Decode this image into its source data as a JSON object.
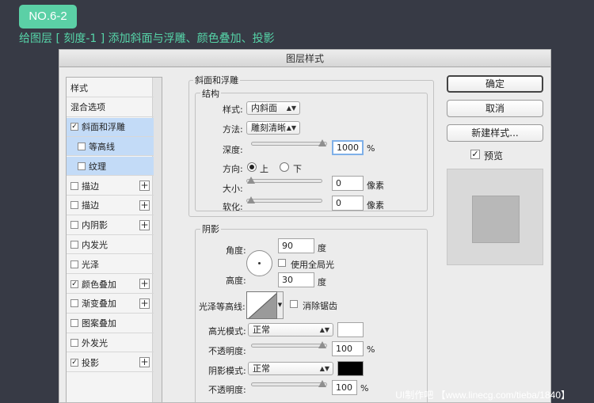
{
  "tutorial": {
    "badge": "NO.6-2",
    "subtitle": "给图层 [ 刻度-1 ] 添加斜面与浮雕、颜色叠加、投影"
  },
  "dialog": {
    "title": "图层样式",
    "buttons": {
      "ok": "确定",
      "cancel": "取消",
      "new_style": "新建样式...",
      "preview": "预览"
    }
  },
  "sidebar": {
    "items": [
      {
        "label": "样式",
        "has_checkbox": false,
        "checked": false,
        "plus": false,
        "selected": false,
        "sub": false
      },
      {
        "label": "混合选项",
        "has_checkbox": false,
        "checked": false,
        "plus": false,
        "selected": false,
        "sub": false
      },
      {
        "label": "斜面和浮雕",
        "has_checkbox": true,
        "checked": true,
        "plus": false,
        "selected": true,
        "sub": false
      },
      {
        "label": "等高线",
        "has_checkbox": true,
        "checked": false,
        "plus": false,
        "selected": true,
        "sub": true
      },
      {
        "label": "纹理",
        "has_checkbox": true,
        "checked": false,
        "plus": false,
        "selected": true,
        "sub": true
      },
      {
        "label": "描边",
        "has_checkbox": true,
        "checked": false,
        "plus": true,
        "selected": false,
        "sub": false
      },
      {
        "label": "描边",
        "has_checkbox": true,
        "checked": false,
        "plus": true,
        "selected": false,
        "sub": false
      },
      {
        "label": "内阴影",
        "has_checkbox": true,
        "checked": false,
        "plus": true,
        "selected": false,
        "sub": false
      },
      {
        "label": "内发光",
        "has_checkbox": true,
        "checked": false,
        "plus": false,
        "selected": false,
        "sub": false
      },
      {
        "label": "光泽",
        "has_checkbox": true,
        "checked": false,
        "plus": false,
        "selected": false,
        "sub": false
      },
      {
        "label": "颜色叠加",
        "has_checkbox": true,
        "checked": true,
        "plus": true,
        "selected": false,
        "sub": false
      },
      {
        "label": "渐变叠加",
        "has_checkbox": true,
        "checked": false,
        "plus": true,
        "selected": false,
        "sub": false
      },
      {
        "label": "图案叠加",
        "has_checkbox": true,
        "checked": false,
        "plus": false,
        "selected": false,
        "sub": false
      },
      {
        "label": "外发光",
        "has_checkbox": true,
        "checked": false,
        "plus": false,
        "selected": false,
        "sub": false
      },
      {
        "label": "投影",
        "has_checkbox": true,
        "checked": true,
        "plus": true,
        "selected": false,
        "sub": false
      }
    ]
  },
  "bevel": {
    "section_title": "斜面和浮雕",
    "structure_title": "结构",
    "style_label": "样式:",
    "style_value": "内斜面",
    "technique_label": "方法:",
    "technique_value": "雕刻清晰",
    "depth_label": "深度:",
    "depth_value": "1000",
    "depth_unit": "%",
    "depth_level": 1.0,
    "direction_label": "方向:",
    "direction_up": "上",
    "direction_down": "下",
    "size_label": "大小:",
    "size_value": "0",
    "size_unit": "像素",
    "size_level": 0.0,
    "soften_label": "软化:",
    "soften_value": "0",
    "soften_unit": "像素",
    "soften_level": 0.0
  },
  "shading": {
    "title": "阴影",
    "angle_label": "角度:",
    "angle_value": "90",
    "angle_unit": "度",
    "global_light_label": "使用全局光",
    "altitude_label": "高度:",
    "altitude_value": "30",
    "altitude_unit": "度",
    "gloss_label": "光泽等高线:",
    "antialias_label": "消除锯齿",
    "highlight_label": "高光模式:",
    "highlight_mode": "正常",
    "highlight_color": "#ffffff",
    "opacity_label": "不透明度:",
    "opacity_value": "100",
    "opacity_unit": "%",
    "opacity_level": 1.0,
    "shadow_label": "阴影模式:",
    "shadow_mode": "正常",
    "shadow_color": "#000000",
    "opacity2_label": "不透明度:",
    "opacity2_value": "100",
    "opacity2_unit": "%",
    "opacity2_level": 1.0
  },
  "watermark": "UI制作吧 【www.linecg.com/tieba/1840】"
}
